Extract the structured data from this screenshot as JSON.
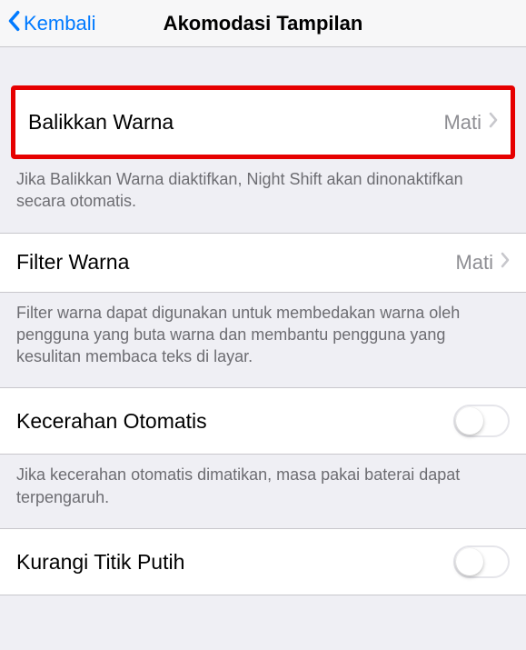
{
  "navbar": {
    "back_label": "Kembali",
    "title": "Akomodasi Tampilan"
  },
  "sections": {
    "invert": {
      "label": "Balikkan Warna",
      "value": "Mati",
      "footer": "Jika Balikkan Warna diaktifkan, Night Shift akan dinonaktifkan secara otomatis."
    },
    "filter": {
      "label": "Filter Warna",
      "value": "Mati",
      "footer": "Filter warna dapat digunakan untuk membedakan warna oleh pengguna yang buta warna dan membantu pengguna yang kesulitan membaca teks di layar."
    },
    "brightness": {
      "label": "Kecerahan Otomatis",
      "footer": "Jika kecerahan otomatis dimatikan, masa pakai baterai dapat terpengaruh."
    },
    "whitepoint": {
      "label": "Kurangi Titik Putih"
    }
  }
}
